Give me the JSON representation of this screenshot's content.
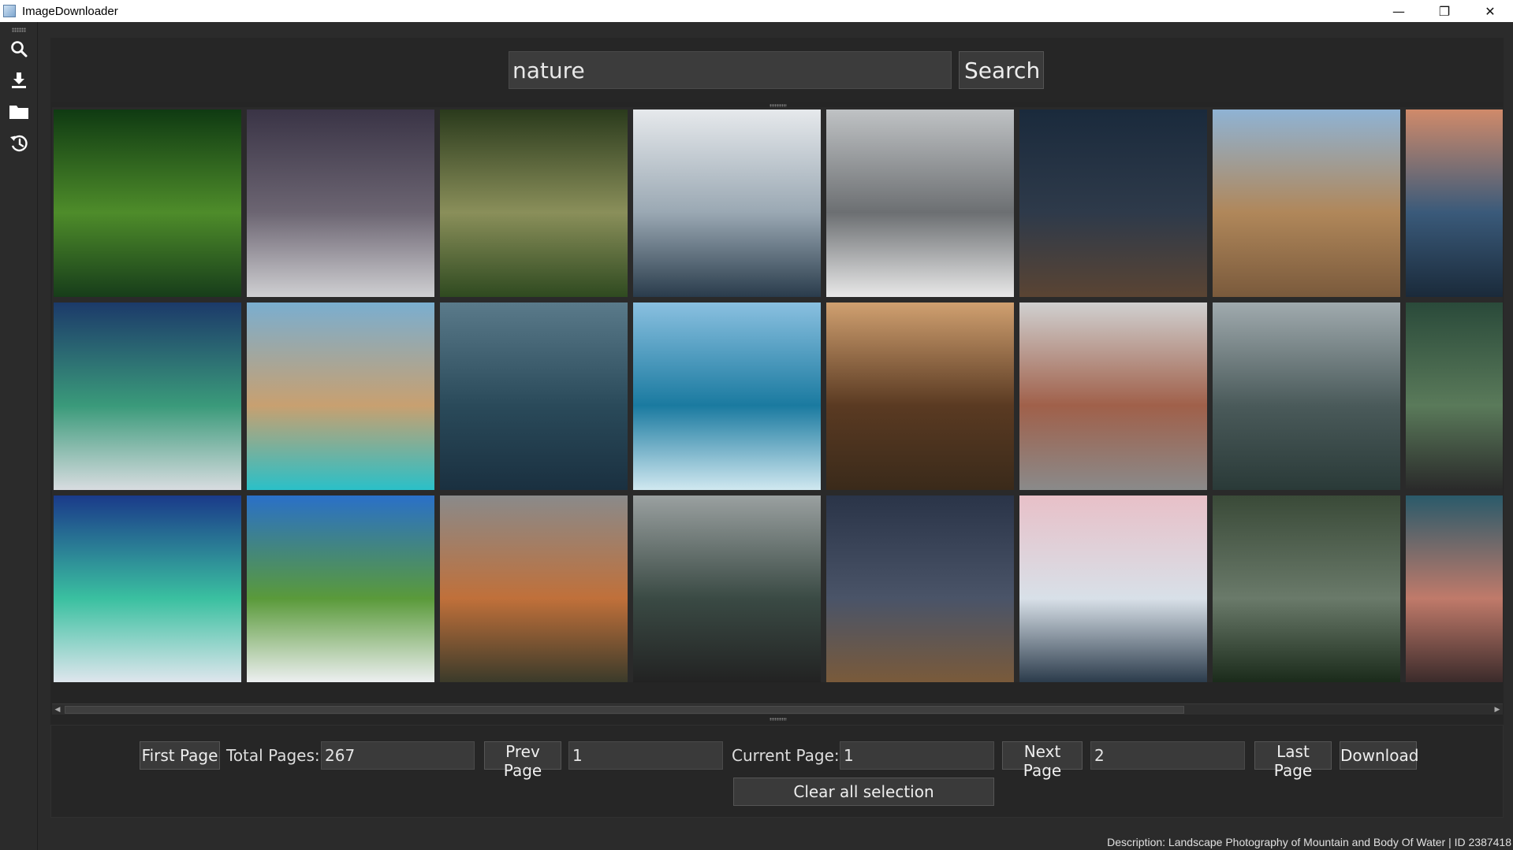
{
  "window": {
    "title": "ImageDownloader",
    "controls": [
      "—",
      "❐",
      "✕"
    ]
  },
  "toolbar": {
    "items": [
      {
        "name": "search-icon"
      },
      {
        "name": "download-icon"
      },
      {
        "name": "folder-icon"
      },
      {
        "name": "history-icon"
      }
    ]
  },
  "search": {
    "value": "nature",
    "button_label": "Search"
  },
  "gallery": {
    "rows": 3,
    "columns_visible": 8,
    "tiles": [
      {
        "desc": "green forest path",
        "c1": "#0f3a12",
        "c2": "#4e8c2a",
        "c3": "#173d1a"
      },
      {
        "desc": "snowy mountain night sky",
        "c1": "#3a3446",
        "c2": "#6c6572",
        "c3": "#cfcfd2"
      },
      {
        "desc": "sunlit forest",
        "c1": "#2a3a1c",
        "c2": "#8a8f5a",
        "c3": "#2f4a20"
      },
      {
        "desc": "misty forest hills",
        "c1": "#e6e9ec",
        "c2": "#9aa8b3",
        "c3": "#2a3c4c"
      },
      {
        "desc": "snowy winter forest",
        "c1": "#bfc2c4",
        "c2": "#6c6f72",
        "c3": "#e8e8e8"
      },
      {
        "desc": "desert rocks at night",
        "c1": "#1a2a3c",
        "c2": "#2e3a4a",
        "c3": "#5a4433"
      },
      {
        "desc": "rocky canyon with snowy peaks",
        "c1": "#8fb3d4",
        "c2": "#b0875a",
        "c3": "#7a5a3c"
      },
      {
        "desc": "sea rock at sunset",
        "c1": "#d08a6a",
        "c2": "#3a5a7a",
        "c3": "#1a2a3a"
      },
      {
        "desc": "aurora over snowy mountains",
        "c1": "#1c3a6a",
        "c2": "#3a9a7a",
        "c3": "#d8dce0"
      },
      {
        "desc": "turquoise mountain lake",
        "c1": "#7aaed0",
        "c2": "#c8a070",
        "c3": "#2ac0c8"
      },
      {
        "desc": "mountain lake reflection",
        "c1": "#5a7a8a",
        "c2": "#2a4a5a",
        "c3": "#1a3040"
      },
      {
        "desc": "ocean wave barrel",
        "c1": "#8ac0e0",
        "c2": "#1a7aa0",
        "c3": "#d0e8f0"
      },
      {
        "desc": "redwood forest trail",
        "c1": "#d0a070",
        "c2": "#5a3a22",
        "c3": "#3a2a1a"
      },
      {
        "desc": "snowy canyon",
        "c1": "#d0d0d0",
        "c2": "#a0604a",
        "c3": "#8a8a8a"
      },
      {
        "desc": "foggy pine forest",
        "c1": "#a0aaae",
        "c2": "#4a5a5a",
        "c3": "#2a3a38"
      },
      {
        "desc": "waterfall cliff",
        "c1": "#2a4a3a",
        "c2": "#5a7a5a",
        "c3": "#2a2a2a"
      },
      {
        "desc": "aurora ice cave",
        "c1": "#1a3a8a",
        "c2": "#3ac0a0",
        "c3": "#e0e6ee"
      },
      {
        "desc": "tropical palm beach",
        "c1": "#2a70c8",
        "c2": "#5a9a3a",
        "c3": "#eef0f2"
      },
      {
        "desc": "cloudy cliff mountain",
        "c1": "#8a8a8a",
        "c2": "#c0703a",
        "c3": "#3a3a2a"
      },
      {
        "desc": "misty forest road",
        "c1": "#9aa0a0",
        "c2": "#3a4a44",
        "c3": "#222"
      },
      {
        "desc": "star trails over mesa",
        "c1": "#2a3448",
        "c2": "#4a5468",
        "c3": "#7a5a3a"
      },
      {
        "desc": "snowy mountain pink sky",
        "c1": "#e8c0c8",
        "c2": "#d8e0e8",
        "c3": "#2a3a4a"
      },
      {
        "desc": "dark misty forest",
        "c1": "#3a4a38",
        "c2": "#6a7a6a",
        "c3": "#1a2a1a"
      },
      {
        "desc": "mountain valley dusk",
        "c1": "#2a5a6a",
        "c2": "#c07a6a",
        "c3": "#3a2a2a"
      }
    ]
  },
  "pager": {
    "first_label": "First Page",
    "total_label": "Total Pages:",
    "total_value": "267",
    "prev_label": "Prev Page",
    "prev_value": "1",
    "current_label": "Current Page:",
    "current_value": "1",
    "next_label": "Next Page",
    "next_value": "2",
    "last_label": "Last Page",
    "download_label": "Download",
    "clear_label": "Clear all selection"
  },
  "status": {
    "text": "Description: Landscape Photography of Mountain and Body Of Water | ID 2387418"
  }
}
